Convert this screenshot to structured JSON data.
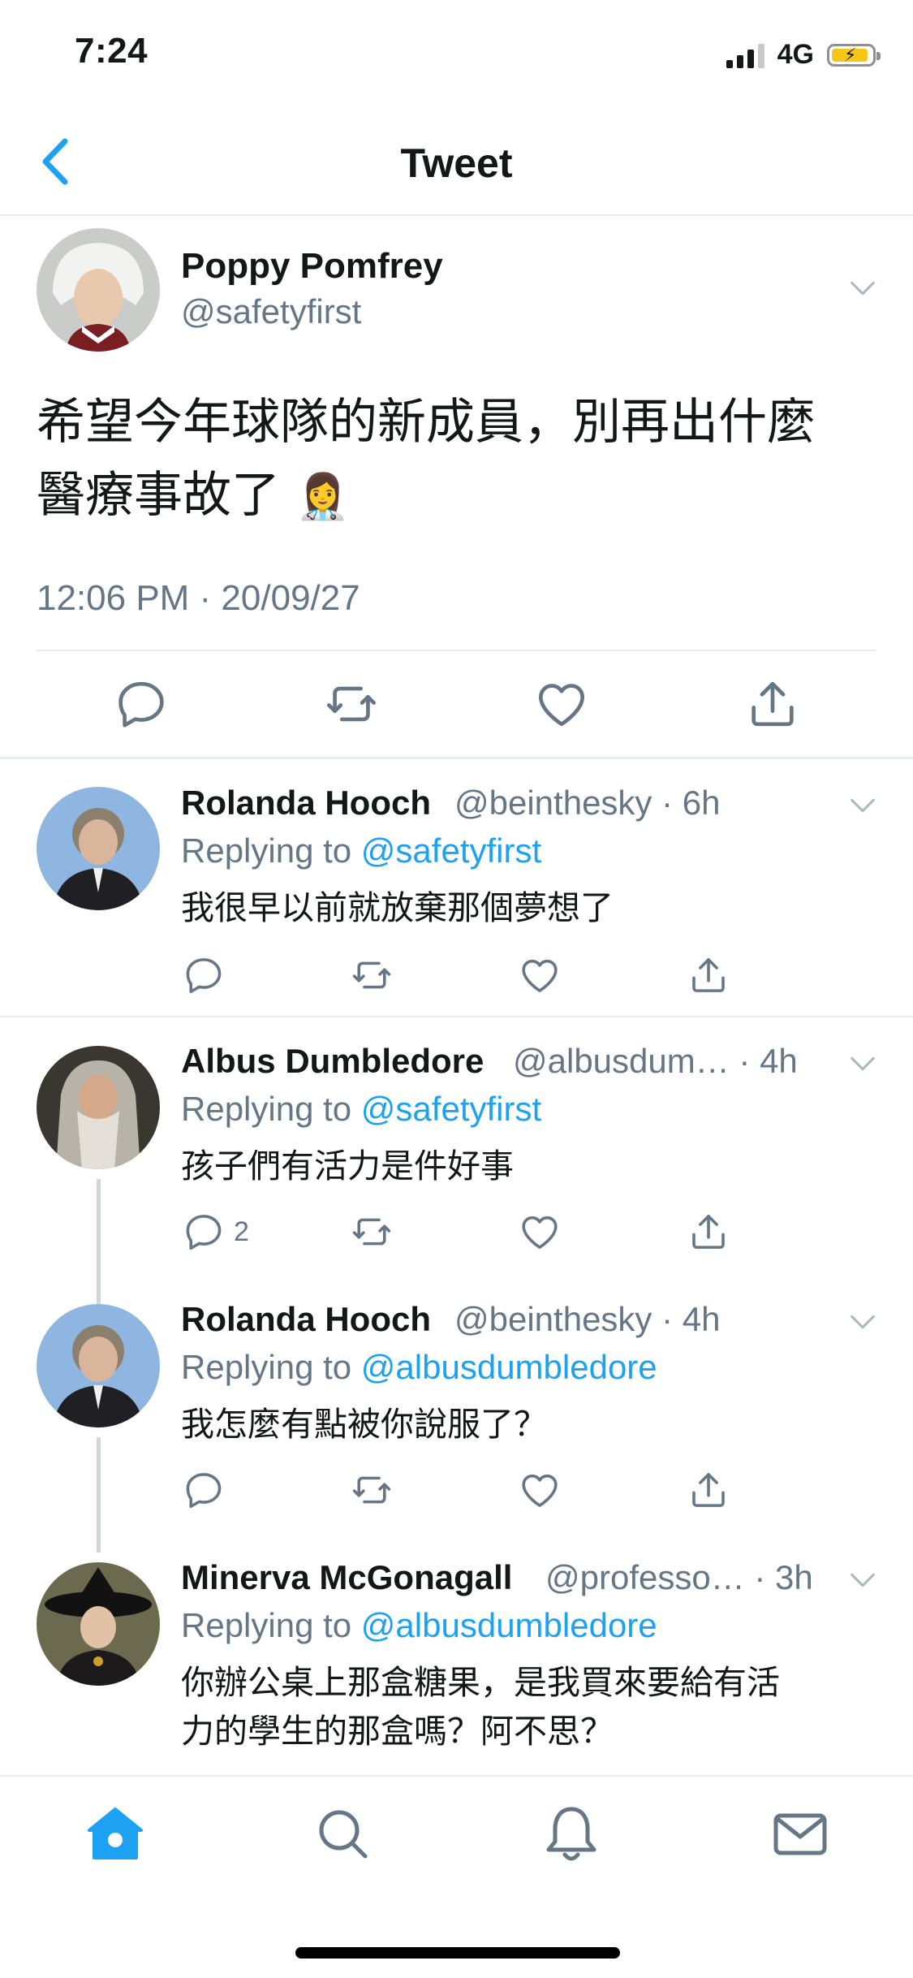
{
  "status_bar": {
    "time": "7:24",
    "network": "4G"
  },
  "nav": {
    "title": "Tweet"
  },
  "main_tweet": {
    "name": "Poppy Pomfrey",
    "handle": "@safetyfirst",
    "text_line1": "希望今年球隊的新成員，別再出什麼",
    "text_line2": "醫療事故了",
    "emoji": "👩‍⚕️",
    "timestamp": "12:06 PM · 20/09/27"
  },
  "replies": [
    {
      "name": "Rolanda Hooch",
      "meta": "@beinthesky · 6h",
      "replying_prefix": "Replying to ",
      "replying_to": "@safetyfirst",
      "text_line1": "我很早以前就放棄那個夢想了",
      "text_line2": "",
      "reply_count": ""
    },
    {
      "name": "Albus Dumbledore",
      "meta": "@albusdum…  · 4h",
      "replying_prefix": "Replying to ",
      "replying_to": "@safetyfirst",
      "text_line1": "孩子們有活力是件好事",
      "text_line2": "",
      "reply_count": "2"
    },
    {
      "name": "Rolanda Hooch",
      "meta": "@beinthesky · 4h",
      "replying_prefix": "Replying to ",
      "replying_to": "@albusdumbledore",
      "text_line1": "我怎麼有點被你說服了？",
      "text_line2": "",
      "reply_count": ""
    },
    {
      "name": "Minerva McGonagall",
      "meta": "@professo… · 3h",
      "replying_prefix": "Replying to ",
      "replying_to": "@albusdumbledore",
      "text_line1": "你辦公桌上那盒糖果，是我買來要給有活",
      "text_line2": "力的學生的那盒嗎？阿不思？",
      "reply_count": ""
    }
  ],
  "icons": {
    "reply": "reply-icon",
    "retweet": "retweet-icon",
    "like": "like-icon",
    "share": "share-icon",
    "home": "home-icon",
    "search": "search-icon",
    "notifications": "bell-icon",
    "messages": "mail-icon"
  },
  "colors": {
    "accent": "#1da1f2",
    "text": "#14171a",
    "secondary": "#657786",
    "divider": "#e6ecf0"
  }
}
